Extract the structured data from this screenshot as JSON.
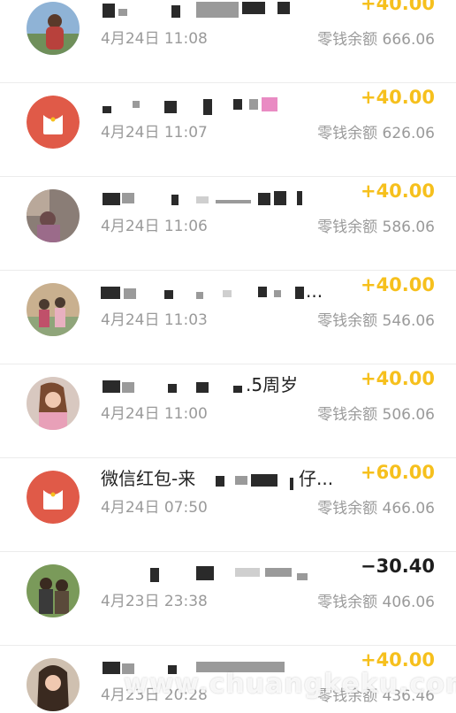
{
  "accent_colors": {
    "income": "#f6c01d",
    "expense": "#1d1d1d",
    "redpacket": "#e05a48",
    "secondary_text": "#9a9a9a"
  },
  "transactions": [
    {
      "title": "",
      "date": "4月24日 11:08",
      "amount": "+40.00",
      "balance": "零钱余额 666.06",
      "avatar": "photo-avatar"
    },
    {
      "title": "",
      "date": "4月24日 11:07",
      "amount": "+40.00",
      "balance": "零钱余额 626.06",
      "avatar": "red-packet-icon"
    },
    {
      "title": "",
      "date": "4月24日 11:06",
      "amount": "+40.00",
      "balance": "零钱余额 586.06",
      "avatar": "photo-avatar"
    },
    {
      "title": "...",
      "date": "4月24日 11:03",
      "amount": "+40.00",
      "balance": "零钱余额 546.06",
      "avatar": "photo-avatar"
    },
    {
      "title": ".5周岁",
      "date": "4月24日 11:00",
      "amount": "+40.00",
      "balance": "零钱余额 506.06",
      "avatar": "photo-avatar"
    },
    {
      "title": "微信红包-来",
      "title_suffix": "仔...",
      "date": "4月24日 07:50",
      "amount": "+60.00",
      "balance": "零钱余额 466.06",
      "avatar": "red-packet-icon"
    },
    {
      "title": "",
      "date": "4月23日 23:38",
      "amount": "−30.40",
      "balance": "零钱余额 406.06",
      "avatar": "photo-avatar"
    },
    {
      "title": "",
      "date": "4月23日 20:28",
      "amount": "+40.00",
      "balance": "零钱余额 436.46",
      "avatar": "photo-avatar"
    }
  ],
  "watermark": "www.chuangkeku.com"
}
